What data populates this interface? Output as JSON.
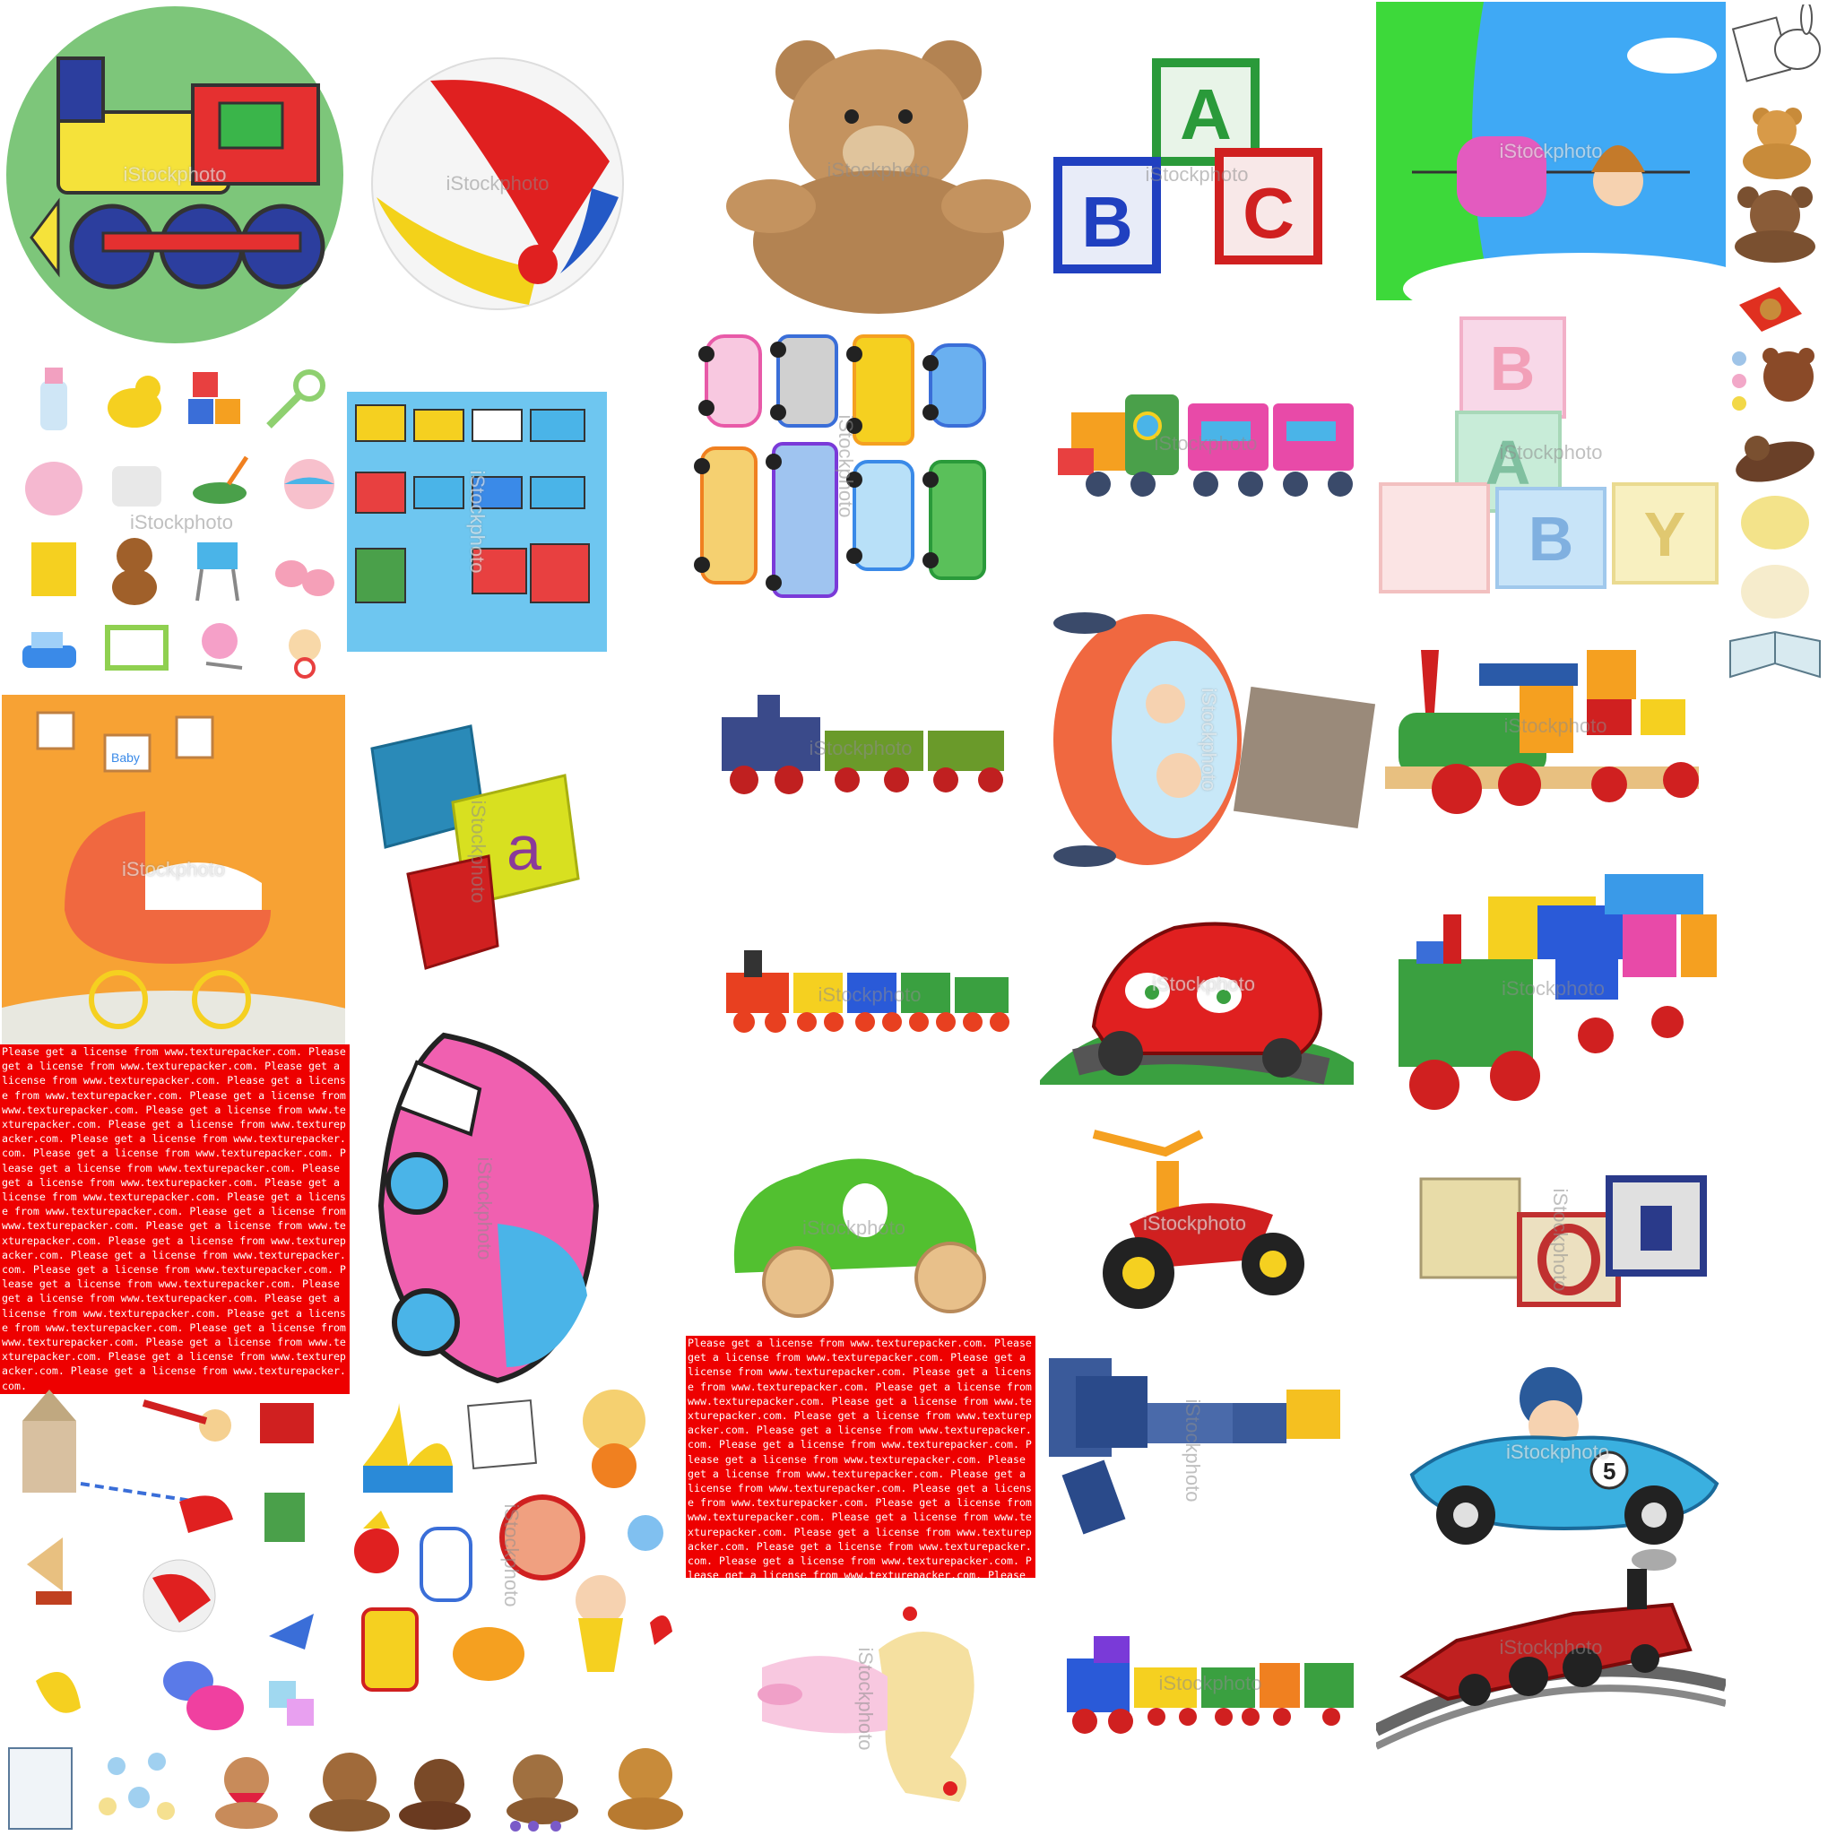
{
  "watermark": "iStockphoto",
  "license_text": "Please get a license from www.texturepacker.com. Please get a license from www.texturepacker.com. Please get a license from www.texturepacker.com. Please get a license from www.texturepacker.com. Please get a license from www.texturepacker.com. Please get a license from www.texturepacker.com. Please get a license from www.texturepacker.com. Please get a license from www.texturepacker.com. Please get a license from www.texturepacker.com. Please get a license from www.texturepacker.com. Please get a license from www.texturepacker.com. Please get a license from www.texturepacker.com. Please get a license from www.texturepacker.com. Please get a license from www.texturepacker.com. Please get a license from www.texturepacker.com. Please get a license from www.texturepacker.com. Please get a license from www.texturepacker.com. Please get a license from www.texturepacker.com. Please get a license from www.texturepacker.com. Please get a license from www.texturepacker.com. Please get a license from www.texturepacker.com. Please get a license from www.texturepacker.com. Please get a license from www.texturepacker.com. Please get a license from www.texturepacker.com. Please get a license from www.texturepacker.com. Please get a license from www.texturepacker.com.",
  "blocks_abc": [
    "A",
    "B",
    "C"
  ],
  "blocks_baby": [
    "B",
    "A",
    "B",
    "Y"
  ],
  "nursery_sign": "Baby",
  "race_number": "5",
  "colors": {
    "license_red": "#ee0000",
    "green_disc": "#7dc67a",
    "sky_blue": "#3fa9f5",
    "orange_wall": "#f7a234",
    "cars_panel": "#6ec6f0"
  }
}
